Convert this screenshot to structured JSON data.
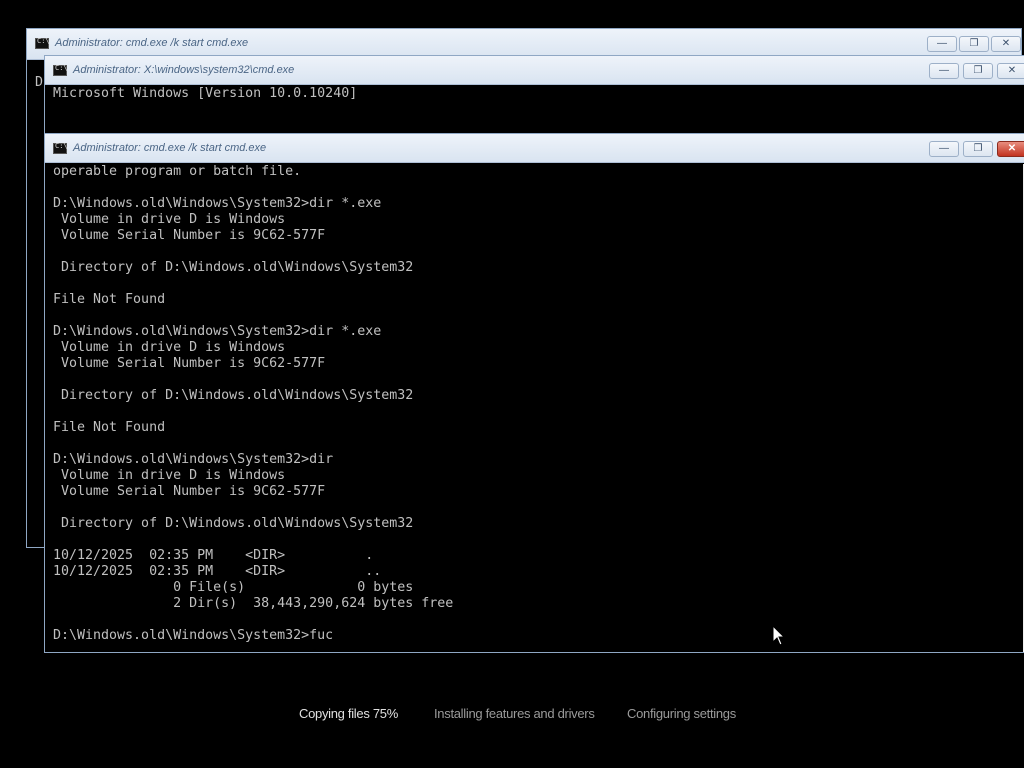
{
  "windows": [
    {
      "title": "Administrator: cmd.exe /k start cmd.exe",
      "lines": [
        "D"
      ]
    },
    {
      "title": "Administrator: X:\\windows\\system32\\cmd.exe",
      "lines": [
        "Microsoft Windows [Version 10.0.10240]"
      ]
    },
    {
      "title": "Administrator: cmd.exe /k start cmd.exe",
      "text": "operable program or batch file.\n\nD:\\Windows.old\\Windows\\System32>dir *.exe\n Volume in drive D is Windows\n Volume Serial Number is 9C62-577F\n\n Directory of D:\\Windows.old\\Windows\\System32\n\nFile Not Found\n\nD:\\Windows.old\\Windows\\System32>dir *.exe\n Volume in drive D is Windows\n Volume Serial Number is 9C62-577F\n\n Directory of D:\\Windows.old\\Windows\\System32\n\nFile Not Found\n\nD:\\Windows.old\\Windows\\System32>dir\n Volume in drive D is Windows\n Volume Serial Number is 9C62-577F\n\n Directory of D:\\Windows.old\\Windows\\System32\n\n10/12/2025  02:35 PM    <DIR>          .\n10/12/2025  02:35 PM    <DIR>          ..\n               0 File(s)              0 bytes\n               2 Dir(s)  38,443,290,624 bytes free\n\nD:\\Windows.old\\Windows\\System32>fuc"
    }
  ],
  "controls": {
    "minimize": "—",
    "restore": "❐",
    "close": "✕"
  },
  "setup_status": {
    "copying": "Copying files 75%",
    "installing": "Installing features and drivers",
    "configuring": "Configuring settings"
  },
  "icons": [
    "cmd-icon",
    "minimize-icon",
    "restore-icon",
    "close-icon",
    "mouse-cursor-icon"
  ]
}
